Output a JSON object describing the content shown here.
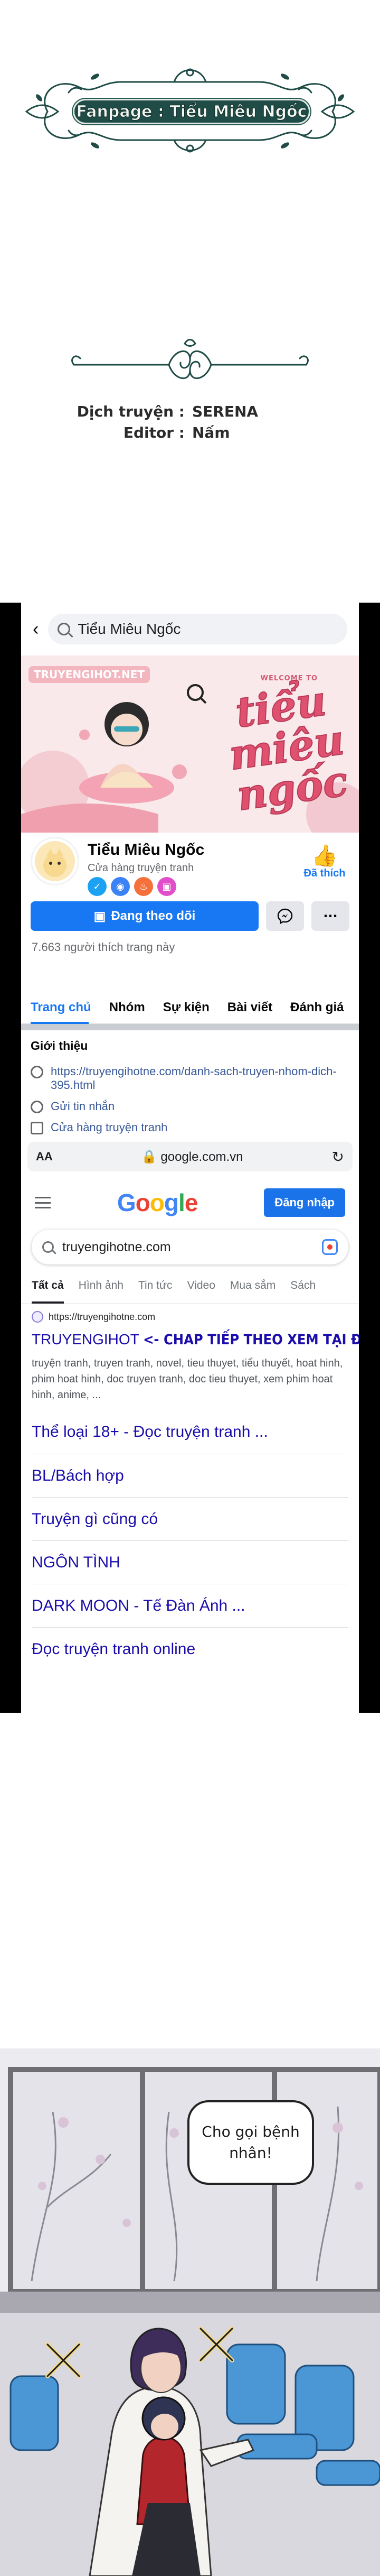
{
  "translator": {
    "fanpage": "Fanpage : Tiểu Miêu Ngốc",
    "translate_label": "Dịch truyện :",
    "translate_value": "SERENA",
    "editor_label": "Editor :",
    "editor_value": "Nấm"
  },
  "facebook": {
    "search_text": "Tiểu Miêu Ngốc",
    "cover": {
      "site_logo": "TRUYENGIHOT.NET",
      "welcome": "WELCOME TO",
      "title_line1": "tiểu",
      "title_line2": "miêu",
      "title_line3": "ngốc"
    },
    "page_name": "Tiểu Miêu Ngốc",
    "category": "Cửa hàng truyện tranh",
    "liked_label": "Đã thích",
    "follow_label": "Đang theo dõi",
    "more_label": "···",
    "likes_count": "7.663 người thích trang này",
    "tabs": [
      "Trang chủ",
      "Nhóm",
      "Sự kiện",
      "Bài viết",
      "Đánh giá"
    ],
    "intro": {
      "heading": "Giới thiệu",
      "link": "https://truyengihotne.com/danh-sach-truyen-nhom-dich-395.html",
      "message": "Gửi tin nhắn",
      "shop": "Cửa hàng truyện tranh"
    }
  },
  "browser": {
    "aa": "AA",
    "domain": "google.com.vn",
    "lock_icon": "lock-icon",
    "reload_icon": "reload-icon"
  },
  "google": {
    "logo": "Google",
    "signin": "Đăng nhập",
    "query": "truyengihotne.com",
    "tabs": [
      "Tất cả",
      "Hình ảnh",
      "Tin tức",
      "Video",
      "Mua sắm",
      "Sách"
    ],
    "result": {
      "url": "https://truyengihotne.com",
      "title": "TRUYENGIHOT",
      "cta": "<- CHAP TIẾP THEO XEM TẠI ĐÂY NHA",
      "snippet": "truyện tranh, truyen tranh, novel, tieu thuyet, tiểu thuyết, hoat hinh, phim hoat hinh, doc truyen tranh, doc tieu thuyet, xem phim hoat hinh, anime, ..."
    },
    "sitelinks": [
      "Thể loại 18+ - Đọc truyện tranh ...",
      "BL/Bách hợp",
      "Truyện gì cũng có",
      "NGÔN TÌNH",
      "DARK MOON - Tế Đàn Ánh ...",
      "Đọc truyện tranh online"
    ]
  },
  "comic": {
    "speech": "Cho gọi bệnh nhân!",
    "colors": {
      "wall": "#ecebf0",
      "chairs": "#4b97d6",
      "frame": "#6f6f73"
    }
  },
  "colors": {
    "fb_blue": "#1877f2",
    "banner_green": "#1f4c46",
    "google_link": "#1a0dab"
  }
}
